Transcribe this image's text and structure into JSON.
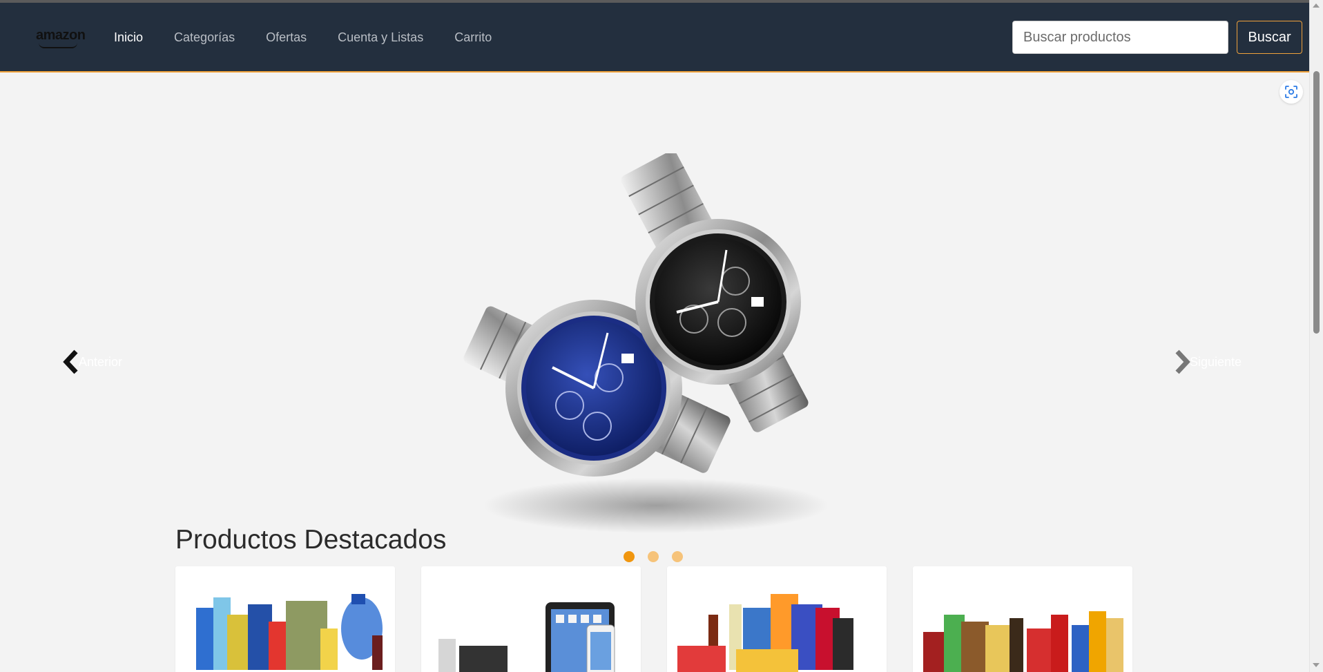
{
  "header": {
    "logo_text": "amazon",
    "nav": [
      {
        "label": "Inicio"
      },
      {
        "label": "Categorías"
      },
      {
        "label": "Ofertas"
      },
      {
        "label": "Cuenta y Listas"
      },
      {
        "label": "Carrito"
      }
    ],
    "active_nav": "Inicio",
    "search": {
      "placeholder": "Buscar productos",
      "value": "",
      "button_label": "Buscar"
    }
  },
  "carousel": {
    "prev_label": "Anterior",
    "next_label": "Siguiente",
    "slide_count": 3,
    "active_slide": 1,
    "image_subject": "two steel chronograph watches"
  },
  "products": {
    "title": "Productos Destacados",
    "items": [
      {
        "image_subject": "grocery and household products"
      },
      {
        "image_subject": "electronics and Apple devices"
      },
      {
        "image_subject": "snacks and pantry groceries"
      },
      {
        "image_subject": "assorted grocery products"
      }
    ]
  },
  "colors": {
    "nav_bg": "#232f3e",
    "accent": "#f0a23b",
    "page_bg": "#f3f3f3",
    "dot_active": "#f0960f",
    "dot_inactive": "#f6c37a"
  },
  "icons": {
    "capture": "screen-capture-icon",
    "prev": "chevron-left-icon",
    "next": "chevron-right-icon"
  }
}
